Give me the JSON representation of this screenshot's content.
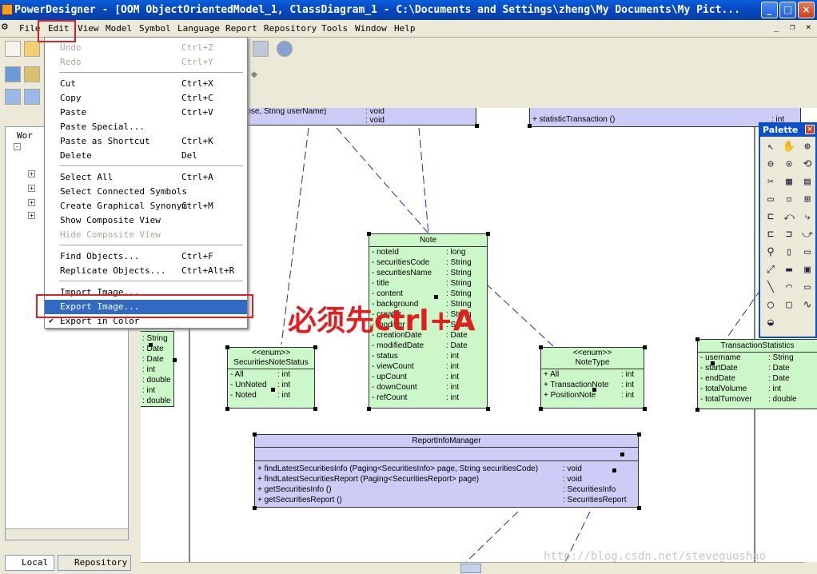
{
  "window": {
    "title": "PowerDesigner - [OOM ObjectOrientedModel_1, ClassDiagram_1 - C:\\Documents and Settings\\zheng\\My Documents\\My Pict..."
  },
  "menubar": [
    "File",
    "Edit",
    "View",
    "Model",
    "Symbol",
    "Language",
    "Report",
    "Repository",
    "Tools",
    "Window",
    "Help"
  ],
  "edit_menu": [
    {
      "label": "Undo",
      "shortcut": "Ctrl+Z",
      "disabled": true
    },
    {
      "label": "Redo",
      "shortcut": "Ctrl+Y",
      "disabled": true
    },
    {
      "label": "Cut",
      "shortcut": "Ctrl+X"
    },
    {
      "label": "Copy",
      "shortcut": "Ctrl+C"
    },
    {
      "label": "Paste",
      "shortcut": "Ctrl+V"
    },
    {
      "label": "Paste Special...",
      "shortcut": ""
    },
    {
      "label": "Paste as Shortcut",
      "shortcut": "Ctrl+K"
    },
    {
      "label": "Delete",
      "shortcut": "Del"
    },
    {
      "label": "Select All",
      "shortcut": "Ctrl+A"
    },
    {
      "label": "Select Connected Symbols",
      "shortcut": ""
    },
    {
      "label": "Create Graphical Synonym",
      "shortcut": "Ctrl+M"
    },
    {
      "label": "Show Composite View",
      "shortcut": ""
    },
    {
      "label": "Hide Composite View",
      "shortcut": "",
      "disabled": true
    },
    {
      "label": "Find Objects...",
      "shortcut": "Ctrl+F"
    },
    {
      "label": "Replicate Objects...",
      "shortcut": "Ctrl+Alt+R"
    },
    {
      "label": "Import Image...",
      "shortcut": ""
    },
    {
      "label": "Export Image...",
      "shortcut": ""
    },
    {
      "label": "Export in Color",
      "shortcut": "",
      "checked": true
    }
  ],
  "annotation": "必须先ctrl+A",
  "tree": {
    "root": "Wor"
  },
  "tabs": [
    "Local",
    "Repository"
  ],
  "palette": {
    "title": "Palette"
  },
  "watermark": "http://blog.csdn.net/steveguoshao",
  "diagram": {
    "top_left_rows": [
      {
        "n": "...ose, String userName)",
        "t": ": void"
      },
      {
        "n": "",
        "t": ": void"
      }
    ],
    "top_right_rows": [
      {
        "n": "+ statisticTransaction ()",
        "t": ": int"
      }
    ],
    "left_partial_types": [
      ": String",
      ": Date",
      ": Date",
      ": int",
      ": double",
      ": int",
      ": double"
    ],
    "note": {
      "name": "Note",
      "rows": [
        {
          "n": "-  noteId",
          "t": ": long"
        },
        {
          "n": "-  securitiesCode",
          "t": ": String"
        },
        {
          "n": "-  securitiesName",
          "t": ": String"
        },
        {
          "n": "-  title",
          "t": ": String"
        },
        {
          "n": "-  content",
          "t": ": String"
        },
        {
          "n": "-  background",
          "t": ": String"
        },
        {
          "n": "-  creator",
          "t": ": String"
        },
        {
          "n": "-  modifier",
          "t": ": String"
        },
        {
          "n": "-  creationDate",
          "t": ": Date"
        },
        {
          "n": "-  modifiedDate",
          "t": ": Date"
        },
        {
          "n": "-  status",
          "t": ": int"
        },
        {
          "n": "-  viewCount",
          "t": ": int"
        },
        {
          "n": "-  upCount",
          "t": ": int"
        },
        {
          "n": "-  downCount",
          "t": ": int"
        },
        {
          "n": "-  refCount",
          "t": ": int"
        }
      ]
    },
    "sns": {
      "stereo": "<<enum>>",
      "name": "SecuritiesNoteStatus",
      "rows": [
        {
          "n": "-  All",
          "t": ": int"
        },
        {
          "n": "-  UnNoted",
          "t": ": int"
        },
        {
          "n": "-  Noted",
          "t": ": int"
        }
      ]
    },
    "nt": {
      "stereo": "<<enum>>",
      "name": "NoteType",
      "rows": [
        {
          "n": "+  All",
          "t": ": int"
        },
        {
          "n": "+  TransactionNote",
          "t": ": int"
        },
        {
          "n": "+  PositionNote",
          "t": ": int"
        }
      ]
    },
    "ts": {
      "name": "TransactionStatistics",
      "rows": [
        {
          "n": "-  username",
          "t": ": String"
        },
        {
          "n": "-  startDate",
          "t": ": Date"
        },
        {
          "n": "-  endDate",
          "t": ": Date"
        },
        {
          "n": "-  totalVolume",
          "t": ": int"
        },
        {
          "n": "-  totalTurnover",
          "t": ": double"
        }
      ]
    },
    "rim": {
      "name": "ReportInfoManager",
      "rows": [
        {
          "n": "+  findLatestSecuritiesInfo (Paging<SecuritiesInfo> page, String securitiesCode)",
          "t": ": void"
        },
        {
          "n": "+  findLatestSecuritiesReport (Paging<SecuritiesReport> page)",
          "t": ": void"
        },
        {
          "n": "+  getSecuritiesInfo ()",
          "t": ": SecuritiesInfo"
        },
        {
          "n": "+  getSecuritiesReport ()",
          "t": ": SecuritiesReport"
        }
      ]
    }
  }
}
